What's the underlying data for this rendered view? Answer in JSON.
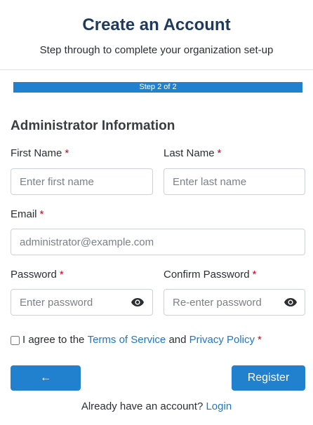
{
  "header": {
    "title": "Create an Account",
    "subtitle": "Step through to complete your organization set-up"
  },
  "progress": {
    "label": "Step 2 of 2",
    "percent": 100,
    "color": "#2181cf"
  },
  "form": {
    "section_title": "Administrator Information",
    "required_marker": "*",
    "first_name": {
      "label": "First Name",
      "placeholder": "Enter first name",
      "value": ""
    },
    "last_name": {
      "label": "Last Name",
      "placeholder": "Enter last name",
      "value": ""
    },
    "email": {
      "label": "Email",
      "placeholder": "administrator@example.com",
      "value": ""
    },
    "password": {
      "label": "Password",
      "placeholder": "Enter password",
      "value": "",
      "toggle_icon": "eye-icon"
    },
    "confirm_password": {
      "label": "Confirm Password",
      "placeholder": "Re-enter password",
      "value": "",
      "toggle_icon": "eye-icon"
    },
    "terms": {
      "prefix": "I agree to the",
      "terms_link": "Terms of Service",
      "conjunction": "and",
      "privacy_link": "Privacy Policy",
      "checked": false
    }
  },
  "actions": {
    "back_label": "←",
    "back_icon": "arrow-left-icon",
    "register_label": "Register"
  },
  "footer": {
    "prompt": "Already have an account?",
    "login_link": "Login"
  },
  "colors": {
    "primary": "#2181cf",
    "title": "#1f3a5c",
    "required": "#d0021b",
    "link": "#1f77c4"
  }
}
